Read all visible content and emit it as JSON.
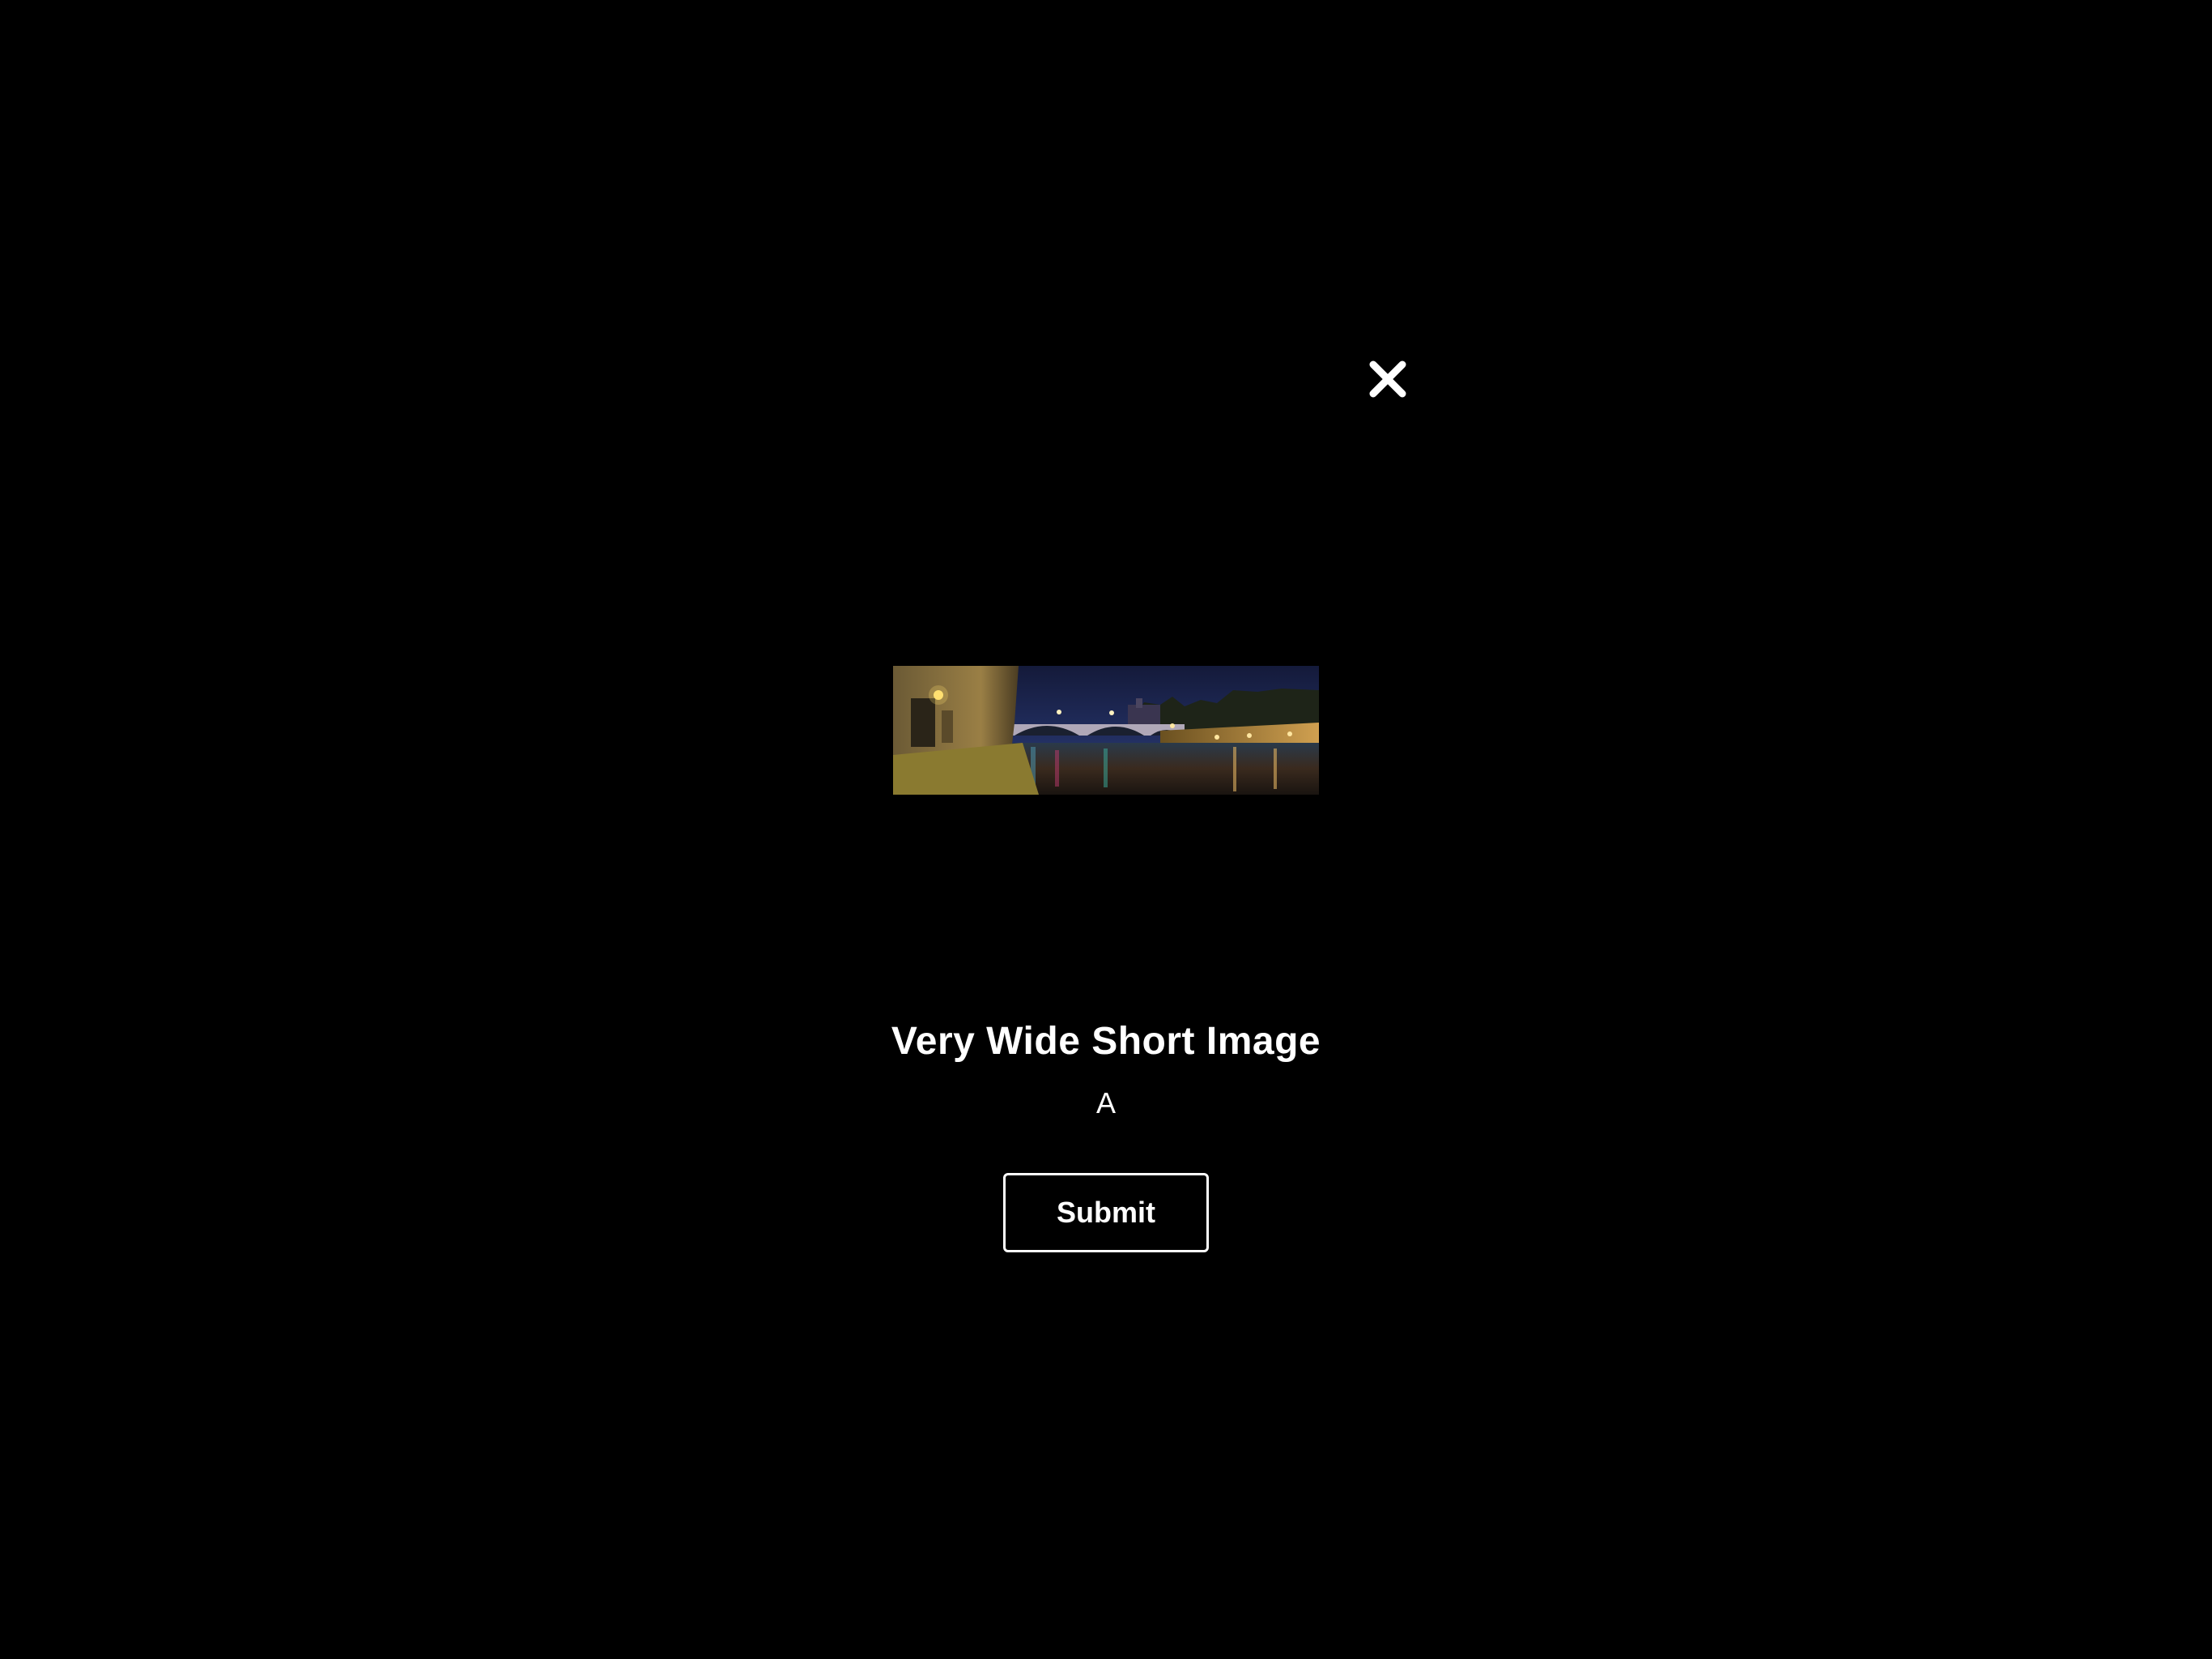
{
  "modal": {
    "close_icon": "close-icon",
    "image_alt": "Panoramic night view of a bridge over a river",
    "title": "Very Wide Short Image",
    "subtitle": "A",
    "submit_label": "Submit"
  },
  "colors": {
    "background": "#000000",
    "text": "#ffffff",
    "button_border": "#ffffff"
  }
}
